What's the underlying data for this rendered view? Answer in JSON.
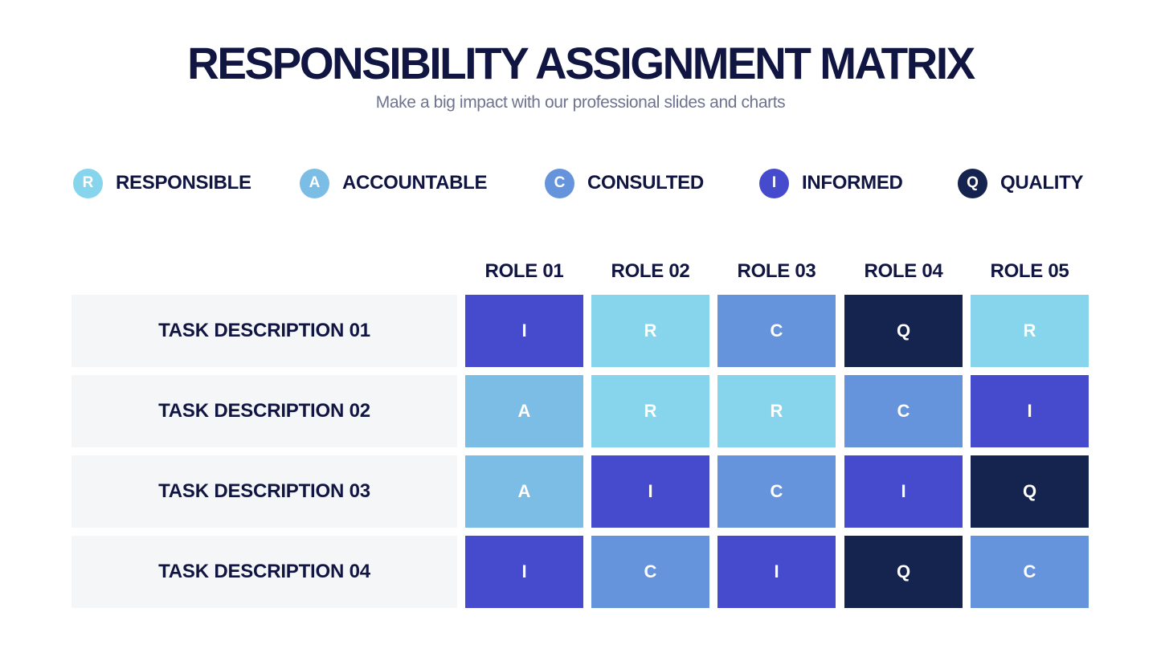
{
  "header": {
    "title": "RESPONSIBILITY ASSIGNMENT MATRIX",
    "subtitle": "Make a big impact with our professional slides and charts"
  },
  "colors": {
    "R": "#86d5ec",
    "A": "#7bbde4",
    "C": "#6593dc",
    "I": "#454bcc",
    "Q": "#15244f"
  },
  "legend": [
    {
      "letter": "R",
      "label": "RESPONSIBLE"
    },
    {
      "letter": "A",
      "label": "ACCOUNTABLE"
    },
    {
      "letter": "C",
      "label": "CONSULTED"
    },
    {
      "letter": "I",
      "label": "INFORMED"
    },
    {
      "letter": "Q",
      "label": "QUALITY"
    }
  ],
  "roles": [
    "ROLE 01",
    "ROLE 02",
    "ROLE 03",
    "ROLE 04",
    "ROLE 05"
  ],
  "tasks": [
    {
      "label": "TASK DESCRIPTION 01",
      "assignments": [
        "I",
        "R",
        "C",
        "Q",
        "R"
      ]
    },
    {
      "label": "TASK DESCRIPTION 02",
      "assignments": [
        "A",
        "R",
        "R",
        "C",
        "I"
      ]
    },
    {
      "label": "TASK DESCRIPTION 03",
      "assignments": [
        "A",
        "I",
        "C",
        "I",
        "Q"
      ]
    },
    {
      "label": "TASK DESCRIPTION 04",
      "assignments": [
        "I",
        "C",
        "I",
        "Q",
        "C"
      ]
    }
  ]
}
